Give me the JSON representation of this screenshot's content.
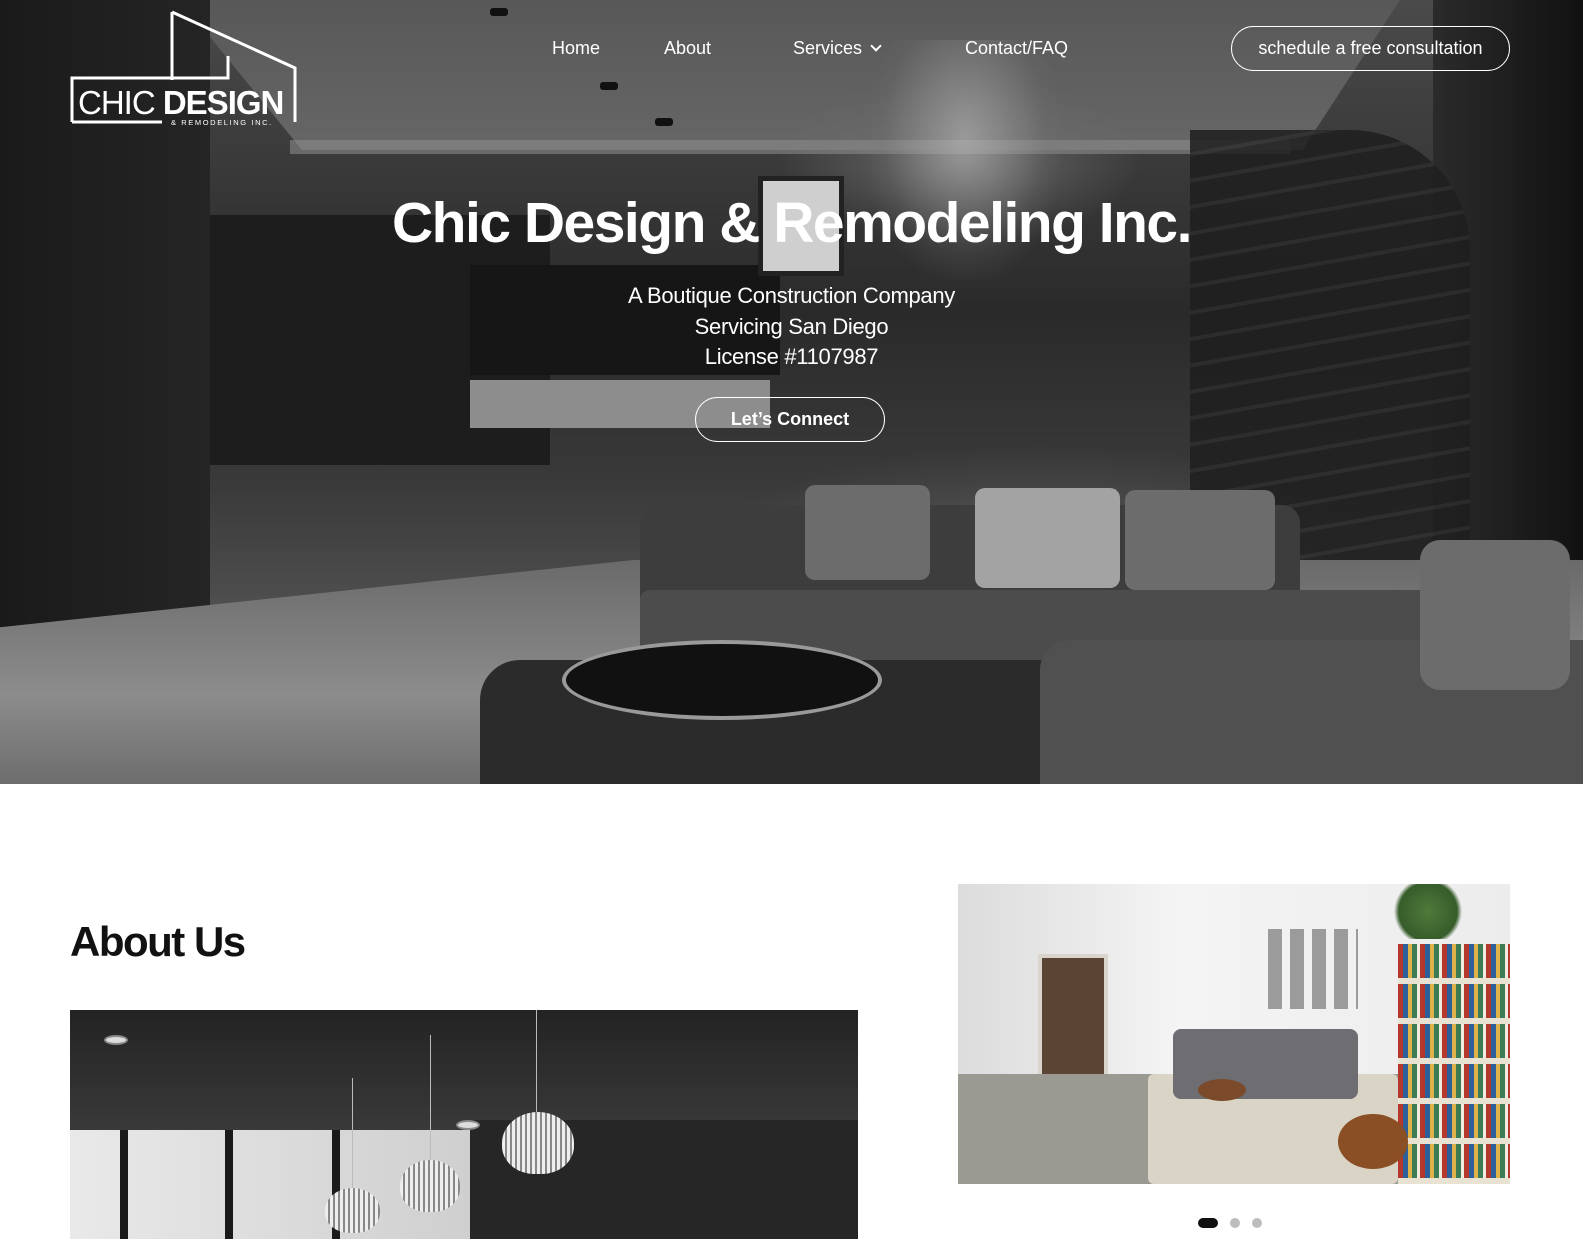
{
  "brand": {
    "name_light": "CHIC",
    "name_bold": "DESIGN",
    "tagline": "& REMODELING INC."
  },
  "nav": {
    "items": [
      {
        "label": "Home"
      },
      {
        "label": "About"
      },
      {
        "label": "Services",
        "has_dropdown": true
      },
      {
        "label": "Contact/FAQ"
      }
    ],
    "cta_label": "schedule a free consultation"
  },
  "hero": {
    "title": "Chic Design & Remodeling Inc.",
    "subtitle_lines": [
      "A Boutique Construction Company",
      "Servicing San Diego",
      "License #1107987"
    ],
    "button_label": "Let’s Connect"
  },
  "about": {
    "heading": "About Us"
  },
  "slider": {
    "slide_count": 3,
    "active_index": 0
  },
  "colors": {
    "text_on_dark": "#ffffff",
    "heading_dark": "#111111",
    "dot_inactive": "#bdbdbd"
  },
  "icons": {
    "services_dropdown": "chevron-down-icon",
    "logo": "house-outline-logo-icon"
  }
}
